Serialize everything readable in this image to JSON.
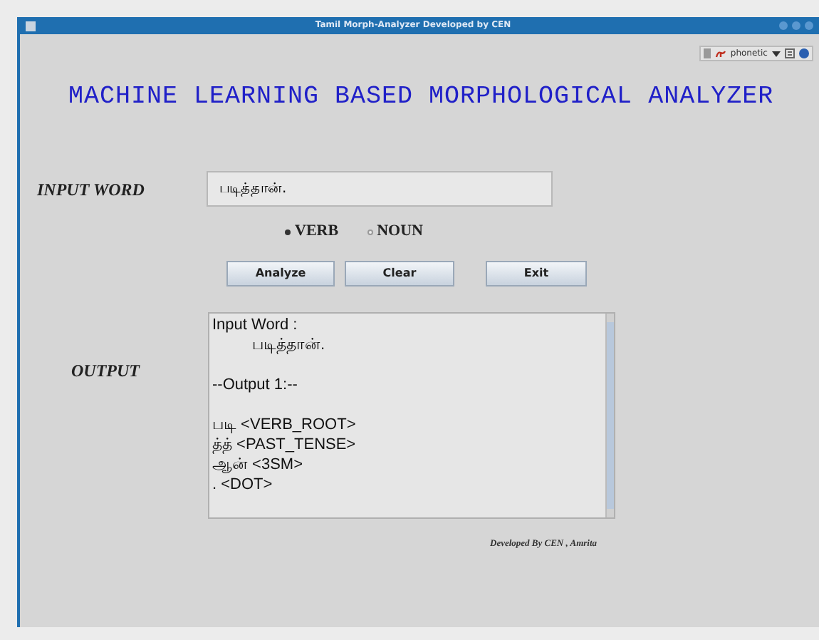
{
  "window": {
    "title": "Tamil Morph-Analyzer Developed by CEN"
  },
  "input_toolbar": {
    "label": "phonetic"
  },
  "heading": "MACHINE LEARNING BASED MORPHOLOGICAL ANALYZER",
  "input_word": {
    "label": "INPUT WORD",
    "value": "படித்தான்."
  },
  "word_type": [
    {
      "label": "VERB",
      "selected": true
    },
    {
      "label": "NOUN",
      "selected": false
    }
  ],
  "buttons": [
    "Analyze",
    "Clear",
    "Exit"
  ],
  "output": {
    "label": "OUTPUT",
    "lines": [
      {
        "kind": "plain",
        "text": "Input Word :"
      },
      {
        "kind": "indented",
        "text": "படித்தான்."
      },
      {
        "kind": "blank"
      },
      {
        "kind": "plain",
        "text": "--Output 1:--"
      },
      {
        "kind": "blank"
      },
      {
        "kind": "plain",
        "text": "படி <VERB_ROOT>"
      },
      {
        "kind": "plain",
        "text": "த்த் <PAST_TENSE>"
      },
      {
        "kind": "plain",
        "text": "ஆன் <3SM>"
      },
      {
        "kind": "plain",
        "text": ". <DOT>"
      }
    ]
  },
  "footer": "Developed By CEN , Amrita"
}
